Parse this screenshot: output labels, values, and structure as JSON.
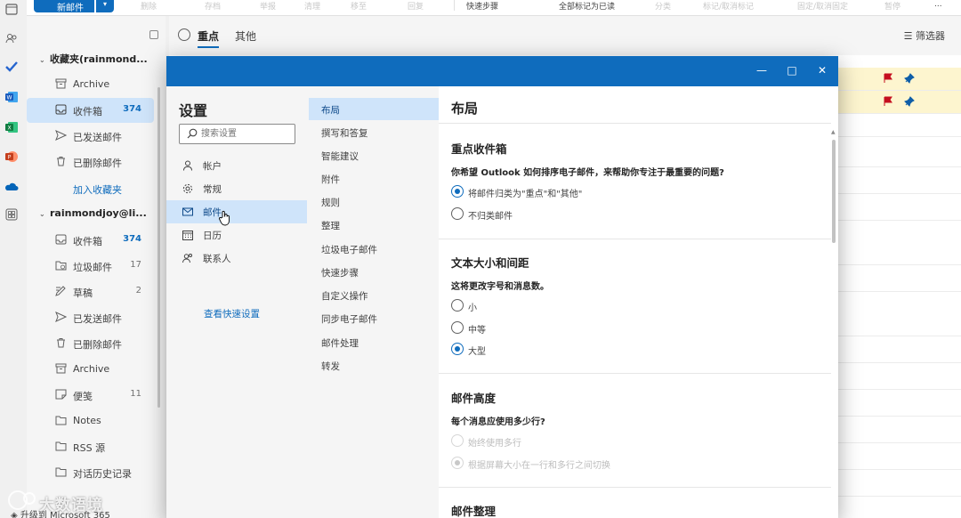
{
  "toolbar": {
    "new_mail_label": "新邮件",
    "items": [
      "删除",
      "存档",
      "举报",
      "清理",
      "移至",
      "回复",
      "快速步骤",
      "全部标记为已读",
      "分类",
      "标记/取消标记",
      "固定/取消固定",
      "暂停",
      "..."
    ]
  },
  "folders": {
    "favorites_header": "收藏夹(rainmond...",
    "favorites": [
      {
        "label": "Archive",
        "icon": "archive-icon"
      },
      {
        "label": "收件箱",
        "count": "374",
        "icon": "inbox-icon",
        "selected": true
      },
      {
        "label": "已发送邮件",
        "icon": "send-icon"
      },
      {
        "label": "已删除邮件",
        "icon": "trash-icon"
      }
    ],
    "add_favorite": "加入收藏夹",
    "account_header": "rainmondjoy@li...",
    "account_folders": [
      {
        "label": "收件箱",
        "count": "374",
        "icon": "inbox-icon"
      },
      {
        "label": "垃圾邮件",
        "count": "17",
        "icon": "junk-icon"
      },
      {
        "label": "草稿",
        "count": "2",
        "icon": "draft-icon"
      },
      {
        "label": "已发送邮件",
        "icon": "send-icon"
      },
      {
        "label": "已删除邮件",
        "icon": "trash-icon"
      },
      {
        "label": "Archive",
        "icon": "archive-icon"
      },
      {
        "label": "便笺",
        "count": "11",
        "icon": "note-icon"
      },
      {
        "label": "Notes",
        "icon": "folder-icon"
      },
      {
        "label": "RSS 源",
        "icon": "folder-icon"
      },
      {
        "label": "对话历史记录",
        "icon": "folder-icon"
      }
    ],
    "upgrade": "升级到 Microsoft 365"
  },
  "list": {
    "tab_focused": "重点",
    "tab_other": "其他",
    "filter": "筛选器"
  },
  "settings": {
    "title": "设置",
    "search_placeholder": "搜索设置",
    "nav1": [
      {
        "label": "帐户",
        "icon": "person-icon"
      },
      {
        "label": "常规",
        "icon": "gear-icon"
      },
      {
        "label": "邮件",
        "icon": "mail-icon",
        "selected": true
      },
      {
        "label": "日历",
        "icon": "calendar-icon"
      },
      {
        "label": "联系人",
        "icon": "people-icon"
      }
    ],
    "quick_settings": "查看快速设置",
    "nav2": [
      "布局",
      "撰写和答复",
      "智能建议",
      "附件",
      "规则",
      "整理",
      "垃圾电子邮件",
      "快速步骤",
      "自定义操作",
      "同步电子邮件",
      "邮件处理",
      "转发"
    ],
    "content": {
      "title": "布局",
      "focused_inbox": {
        "heading": "重点收件箱",
        "question": "你希望 Outlook 如何排序电子邮件，来帮助你专注于最重要的问题?",
        "options": [
          "将邮件归类为\"重点\"和\"其他\"",
          "不归类邮件"
        ],
        "selected": 0
      },
      "text_size": {
        "heading": "文本大小和间距",
        "question": "这将更改字号和消息数。",
        "options": [
          "小",
          "中等",
          "大型"
        ],
        "selected": 2
      },
      "message_height": {
        "heading": "邮件高度",
        "question": "每个消息应使用多少行?",
        "options": [
          "始终使用多行",
          "根据屏幕大小在一行和多行之间切换"
        ],
        "selected": 1
      },
      "organize": {
        "heading": "邮件整理"
      }
    }
  },
  "colors": {
    "accent": "#0f6cbd",
    "selected_bg": "#cfe4fa",
    "flag_red": "#c50f1f",
    "pin_blue": "#0f5ea8",
    "highlight_row": "#fdf5cf"
  },
  "watermark": "大数语境"
}
